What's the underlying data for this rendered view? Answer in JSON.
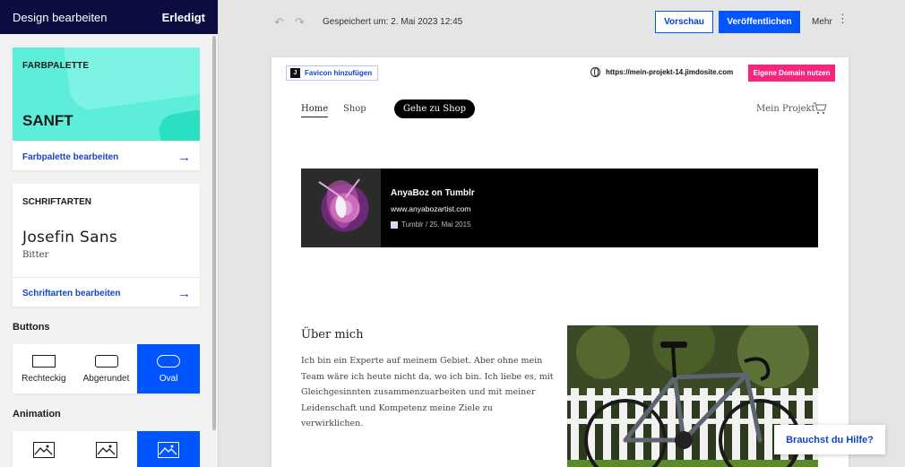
{
  "sidebar": {
    "title": "Design bearbeiten",
    "done_label": "Erledigt",
    "palette": {
      "label": "FARBPALETTE",
      "name": "SANFT",
      "edit_label": "Farbpalette bearbeiten"
    },
    "fonts": {
      "label": "SCHRIFTARTEN",
      "primary": "Josefin Sans",
      "secondary": "Bitter",
      "edit_label": "Schriftarten bearbeiten"
    },
    "buttons": {
      "title": "Buttons",
      "options": [
        "Rechteckig",
        "Abgerundet",
        "Oval"
      ],
      "selected": "Oval"
    },
    "animation": {
      "title": "Animation"
    }
  },
  "toolbar": {
    "saved_text": "Gespeichert um: 2. Mai 2023 12:45",
    "preview_label": "Vorschau",
    "publish_label": "Veröffentlichen",
    "more_label": "Mehr"
  },
  "site": {
    "favicon_label": "Favicon hinzufügen",
    "favicon_initial": "J",
    "url": "https://mein-projekt-14.jimdosite.com",
    "domain_label": "Eigene Domain nutzen",
    "nav": {
      "home": "Home",
      "shop": "Shop",
      "shop_button": "Gehe zu Shop",
      "project": "Mein Projekt"
    },
    "embed": {
      "title": "AnyaBoz on Tumblr",
      "url": "www.anyabozartist.com",
      "meta": "Tumblr / 25. Mai 2015"
    },
    "about": {
      "title": "Über mich",
      "text": "Ich bin ein Experte auf meinem Gebiet. Aber ohne mein Team wäre ich heute nicht da, wo ich bin. Ich liebe es, mit Gleichgesinnten zusammenzuarbeiten und mit meiner Leidenschaft und Kompetenz meine Ziele zu verwirklichen."
    }
  },
  "help_label": "Brauchst du Hilfe?",
  "colors": {
    "sidebar_header": "#0b0d40",
    "accent_blue": "#0055ff",
    "palette_mint": "#5ceed9",
    "domain_pink": "#f5267e"
  }
}
